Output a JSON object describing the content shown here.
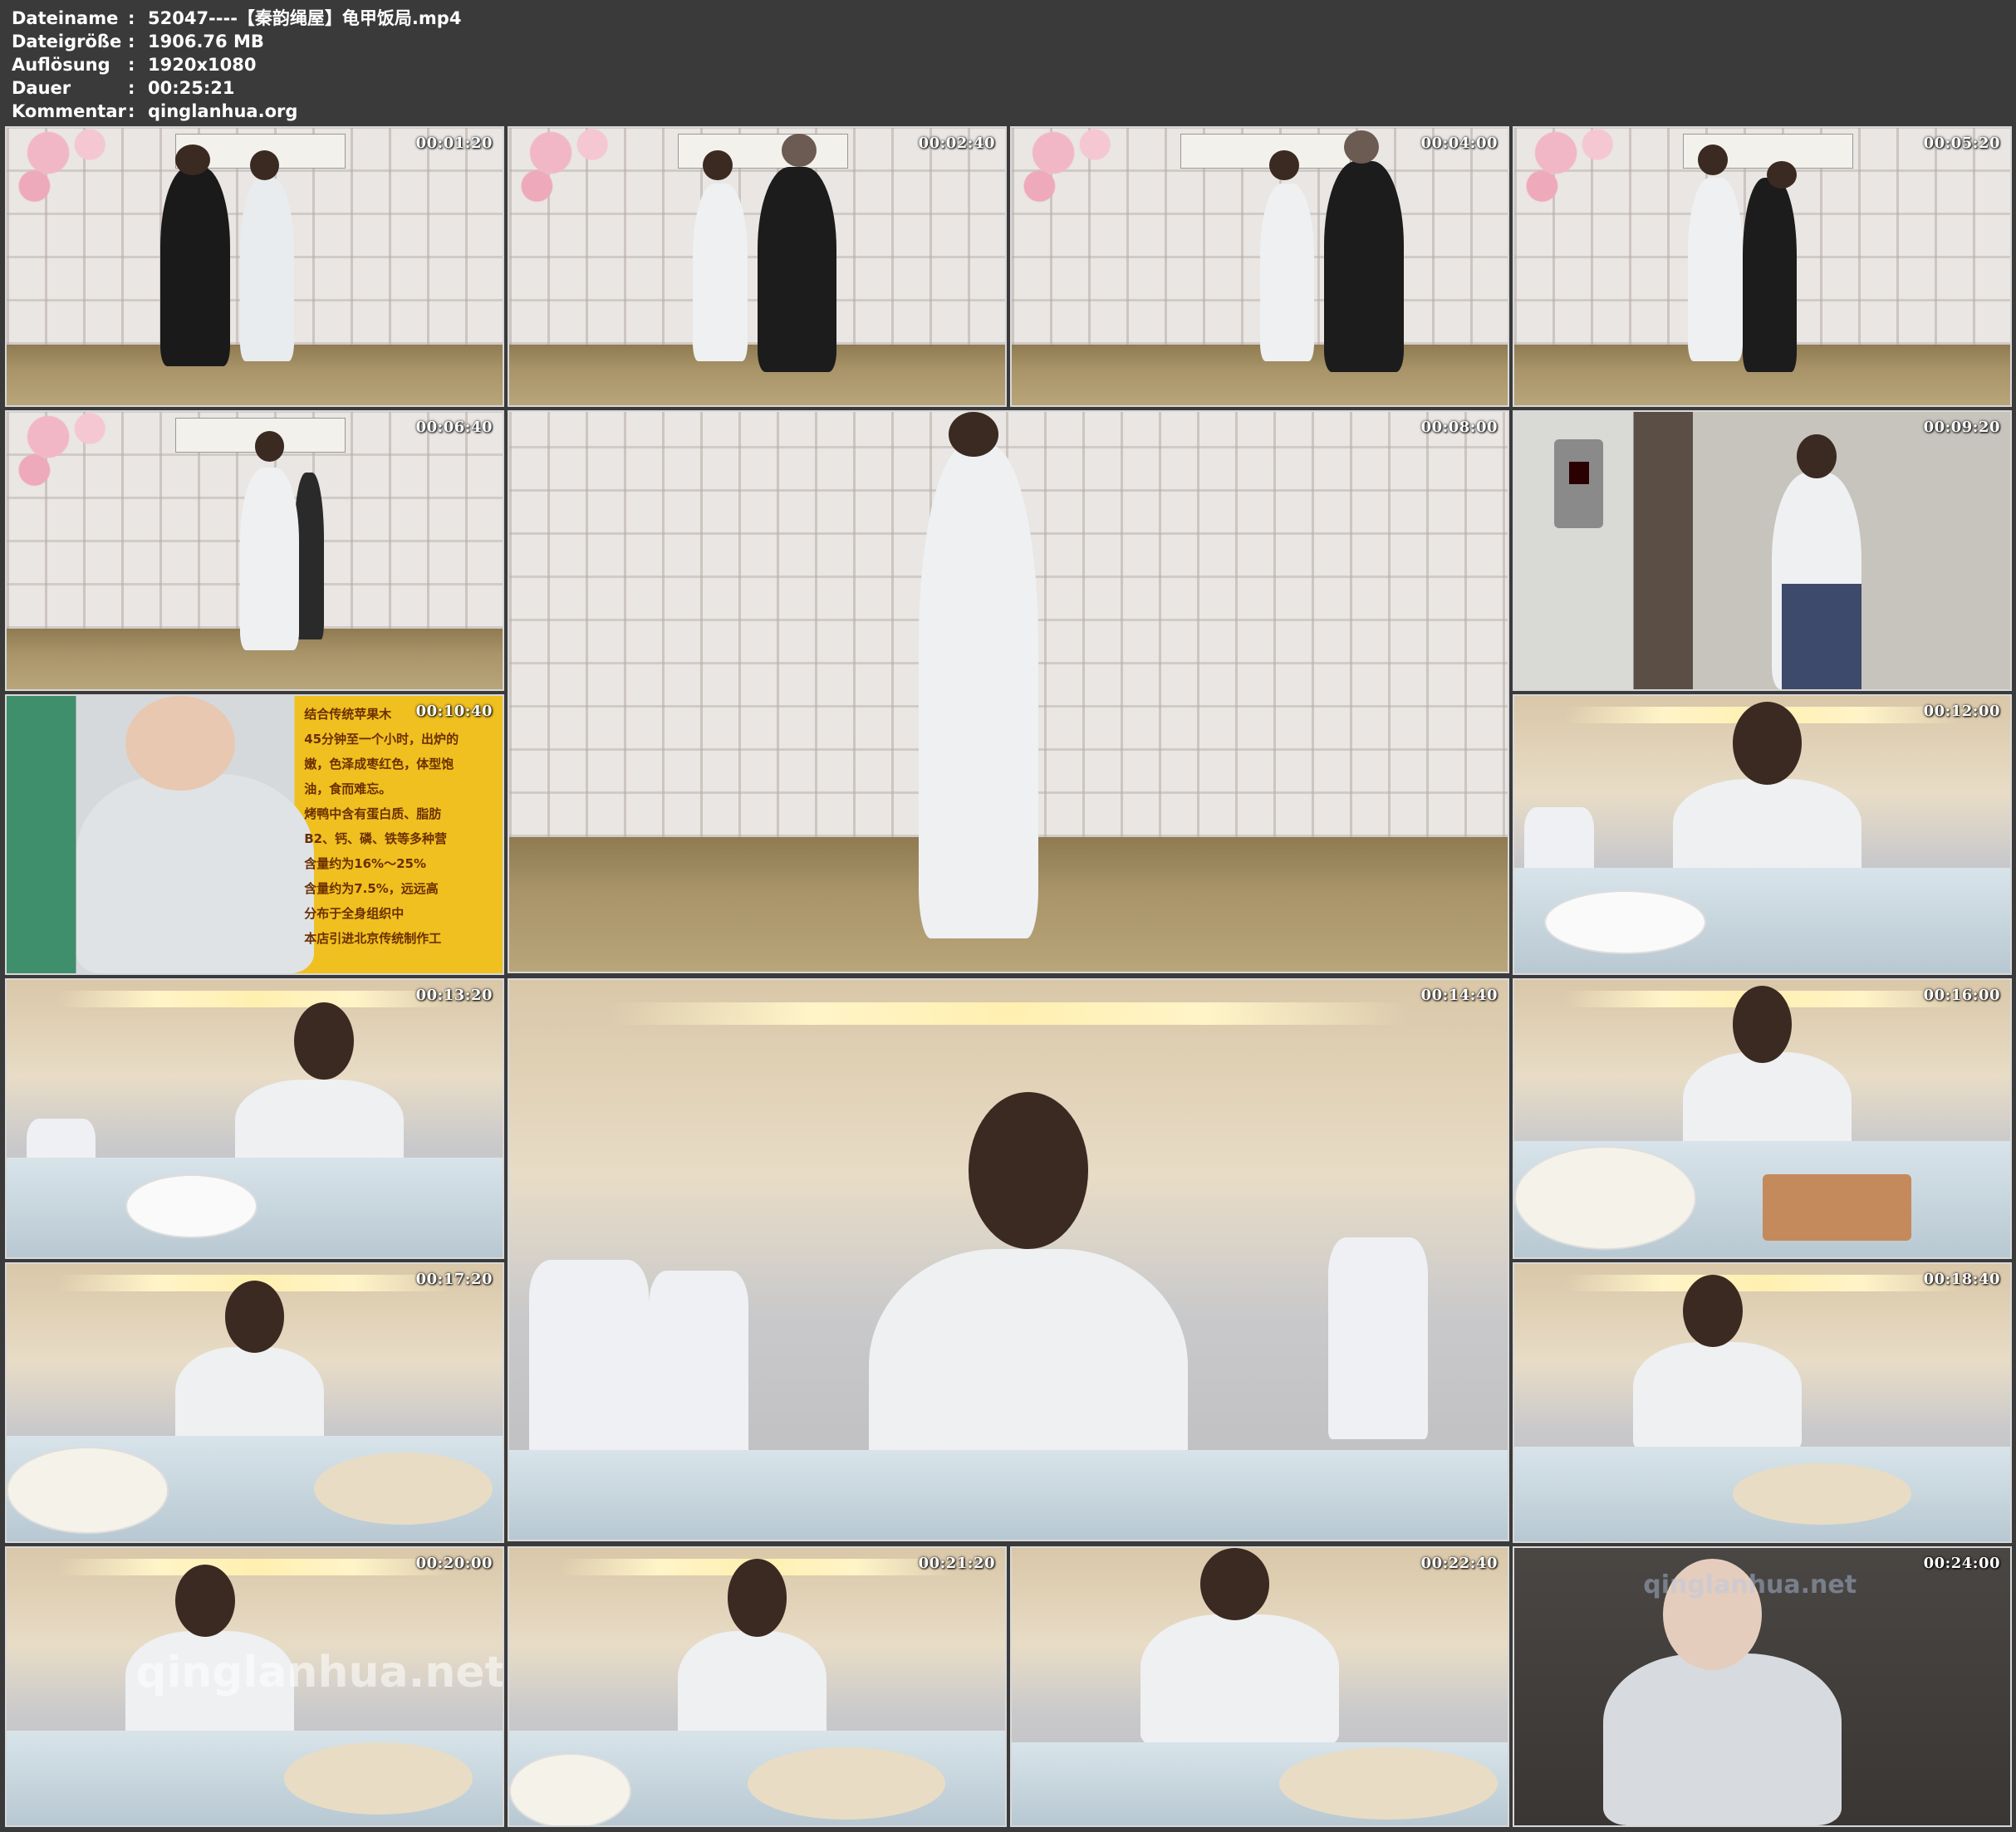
{
  "info": {
    "rows": [
      {
        "label": "Dateiname",
        "value": "52047----【秦韵绳屋】龟甲饭局.mp4"
      },
      {
        "label": "Dateigröße",
        "value": "1906.76 MB"
      },
      {
        "label": "Auflösung",
        "value": "1920x1080"
      },
      {
        "label": "Dauer",
        "value": "00:25:21"
      },
      {
        "label": "Kommentar",
        "value": "qinglanhua.org"
      }
    ],
    "separator": ":"
  },
  "thumbnails": [
    {
      "timestamp": "00:01:20",
      "scene": "studio"
    },
    {
      "timestamp": "00:02:40",
      "scene": "studio"
    },
    {
      "timestamp": "00:04:00",
      "scene": "studio"
    },
    {
      "timestamp": "00:05:20",
      "scene": "studio"
    },
    {
      "timestamp": "00:06:40",
      "scene": "studio"
    },
    {
      "timestamp": "00:08:00",
      "scene": "studio-large"
    },
    {
      "timestamp": "00:09:20",
      "scene": "elevator"
    },
    {
      "timestamp": "00:10:40",
      "scene": "sign"
    },
    {
      "timestamp": "00:12:00",
      "scene": "restaurant"
    },
    {
      "timestamp": "00:13:20",
      "scene": "restaurant"
    },
    {
      "timestamp": "00:14:40",
      "scene": "restaurant-large"
    },
    {
      "timestamp": "00:16:00",
      "scene": "restaurant"
    },
    {
      "timestamp": "00:17:20",
      "scene": "restaurant"
    },
    {
      "timestamp": "00:18:40",
      "scene": "restaurant"
    },
    {
      "timestamp": "00:20:00",
      "scene": "restaurant"
    },
    {
      "timestamp": "00:21:20",
      "scene": "restaurant"
    },
    {
      "timestamp": "00:22:40",
      "scene": "restaurant"
    },
    {
      "timestamp": "00:24:00",
      "scene": "night"
    }
  ],
  "sign_text": [
    "结合传统苹果木",
    "45分钟至一个小时，出炉的",
    "嫩，色泽成枣红色，体型饱",
    "油，食而难忘。",
    "烤鸭中含有蛋白质、脂肪",
    "B2、钙、磷、铁等多种营",
    "含量约为16%～25%",
    "含量约为7.5%，远远高",
    "分布于全身组织中",
    "本店引进北京传统制作工"
  ],
  "watermarks": {
    "bottom_left": "qinglanhua.net",
    "bottom_right": "qinglanhua.net"
  },
  "colors": {
    "background": "#3a3a3a",
    "text": "#ffffff",
    "tile_border": "#d8d8d8"
  }
}
